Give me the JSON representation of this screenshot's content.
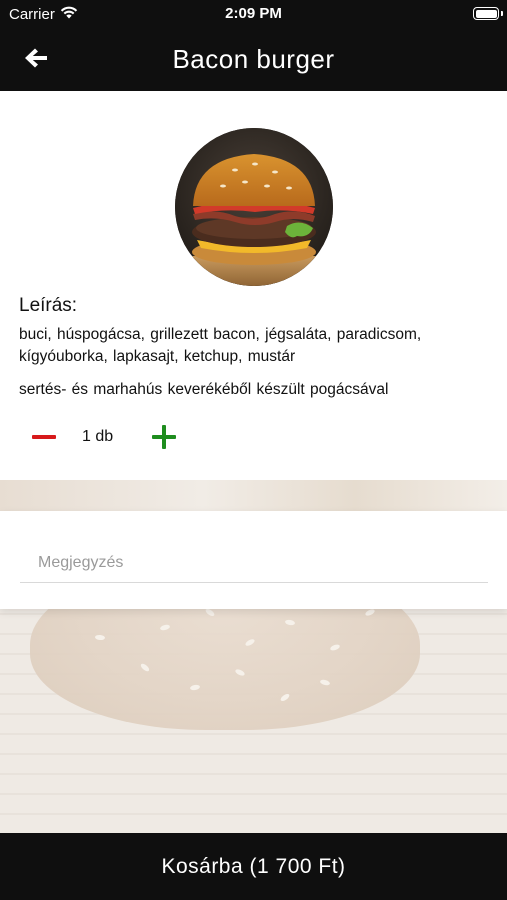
{
  "status_bar": {
    "carrier": "Carrier",
    "time": "2:09 PM",
    "wifi_icon": "wifi-icon",
    "battery_icon": "battery-full-icon"
  },
  "nav": {
    "back_icon": "arrow-left-icon",
    "title": "Bacon burger"
  },
  "product": {
    "image": "burger-photo",
    "description_heading": "Leírás:",
    "ingredients": "buci, húspogácsa, grillezett bacon, jégsaláta, paradicsom, kígyóuborka, lapkasajt, ketchup, mustár",
    "note": "sertés- és marhahús keverékéből készült pogácsával",
    "quantity": {
      "minus_icon": "minus-icon",
      "value": "1 db",
      "plus_icon": "plus-icon",
      "minus_color": "#d7191b",
      "plus_color": "#1e8d1e"
    }
  },
  "note_field": {
    "placeholder": "Megjegyzés",
    "value": ""
  },
  "cart_button": {
    "label": "Kosárba (1 700 Ft)"
  },
  "colors": {
    "bar_background": "#0f0f0f",
    "card_background": "#ffffff"
  }
}
